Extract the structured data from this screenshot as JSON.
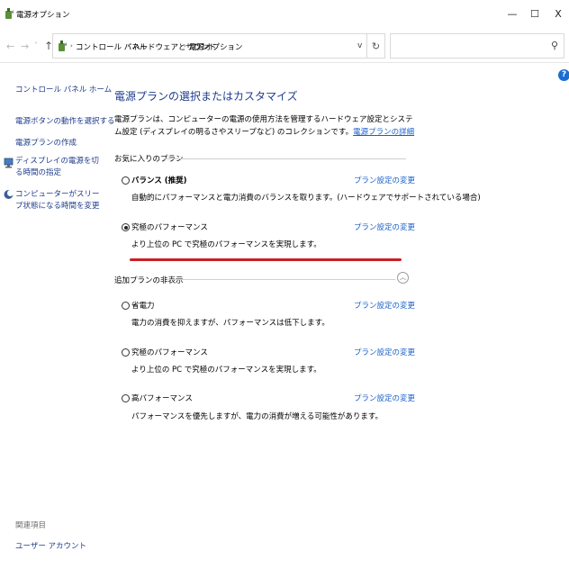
{
  "window": {
    "title": "電源オプション",
    "min_glyph": "—",
    "max_glyph": "☐",
    "close_glyph": "X"
  },
  "address": {
    "breadcrumbs": [
      "コントロール パネル",
      "ハードウェアとサウンド",
      "電源オプション"
    ],
    "separator": "›",
    "search_placeholder": ""
  },
  "sidebar": {
    "home": "コントロール パネル ホーム",
    "items": [
      {
        "label": "電源ボタンの動作を選択する"
      },
      {
        "label": "電源プランの作成"
      },
      {
        "label": "ディスプレイの電源を切る時間の指定",
        "icon": "display-power-icon"
      },
      {
        "label": "コンピューターがスリープ状態になる時間を変更",
        "icon": "moon-icon"
      }
    ],
    "related_title": "関連項目",
    "related_links": [
      "ユーザー アカウント"
    ]
  },
  "main": {
    "title": "電源プランの選択またはカスタマイズ",
    "description": "電源プランは、コンピューターの電源の使用方法を管理するハードウェア設定とシステム設定 (ディスプレイの明るさやスリープなど) のコレクションです。",
    "description_link": "電源プランの詳細",
    "favorites_label": "お気に入りのプラン",
    "hidden_label": "追加プランの非表示",
    "favorite_plans": [
      {
        "name": "バランス (推奨)",
        "desc": "自動的にパフォーマンスと電力消費のバランスを取ります。(ハードウェアでサポートされている場合)",
        "link": "プラン設定の変更",
        "checked": false
      },
      {
        "name": "究極のパフォーマンス",
        "desc": "より上位の PC で究極のパフォーマンスを実現します。",
        "link": "プラン設定の変更",
        "checked": true
      }
    ],
    "additional_plans": [
      {
        "name": "省電力",
        "desc": "電力の消費を抑えますが、パフォーマンスは低下します。",
        "link": "プラン設定の変更",
        "checked": false
      },
      {
        "name": "究極のパフォーマンス",
        "desc": "より上位の PC で究極のパフォーマンスを実現します。",
        "link": "プラン設定の変更",
        "checked": false
      },
      {
        "name": "高パフォーマンス",
        "desc": "パフォーマンスを優先しますが、電力の消費が増える可能性があります。",
        "link": "プラン設定の変更",
        "checked": false
      }
    ]
  },
  "colors": {
    "accent": "#1e3c8c",
    "link": "#1a5fc9",
    "highlight": "#cc2020"
  }
}
